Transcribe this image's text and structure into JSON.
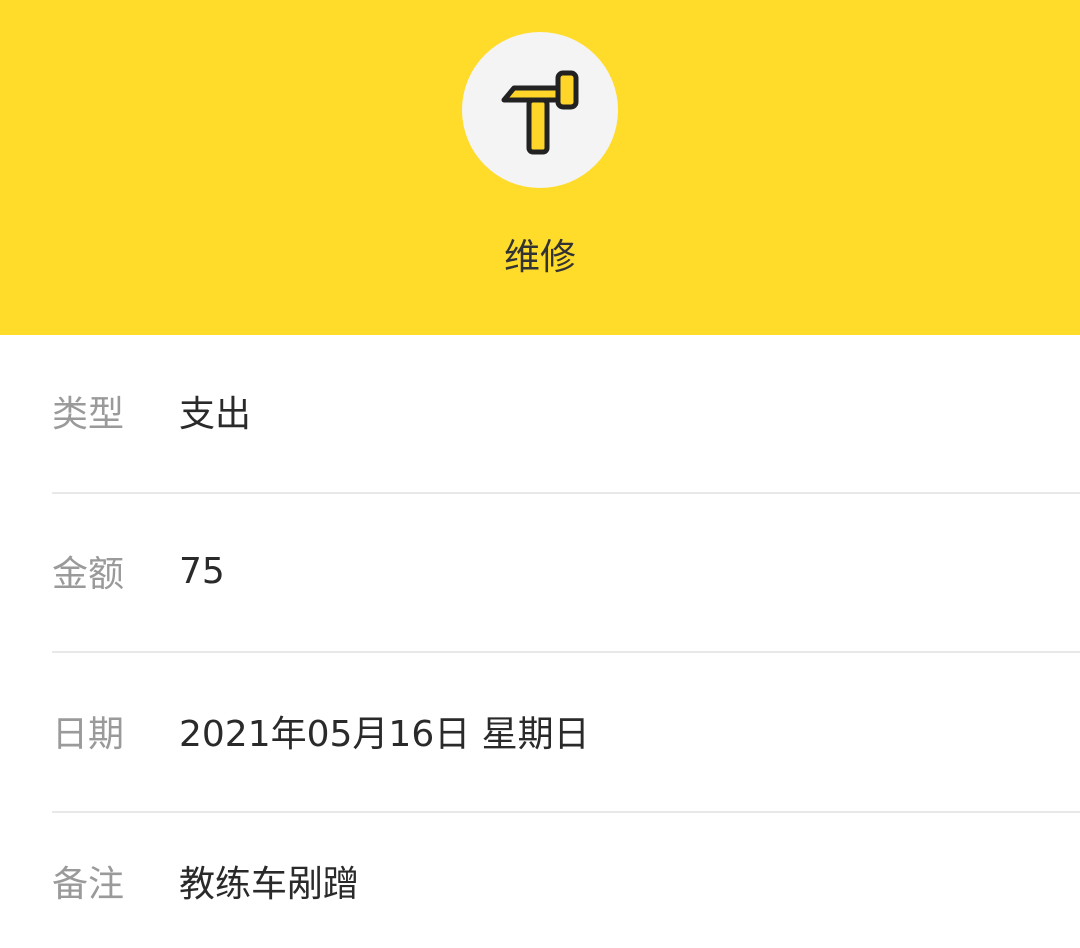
{
  "colors": {
    "header_bg": "#FFDB2A",
    "icon_circle_bg": "#F4F4F4",
    "icon_fill": "#FFD52A",
    "icon_stroke": "#222222",
    "label_text": "#9A9A9A",
    "value_text": "#2A2A2A",
    "divider": "#E8E8E8"
  },
  "header": {
    "icon": "hammer-icon",
    "category": "维修"
  },
  "details": [
    {
      "label": "类型",
      "value": "支出"
    },
    {
      "label": "金额",
      "value": "75"
    },
    {
      "label": "日期",
      "value": "2021年05月16日 星期日"
    },
    {
      "label": "备注",
      "value": "教练车剐蹭"
    }
  ]
}
